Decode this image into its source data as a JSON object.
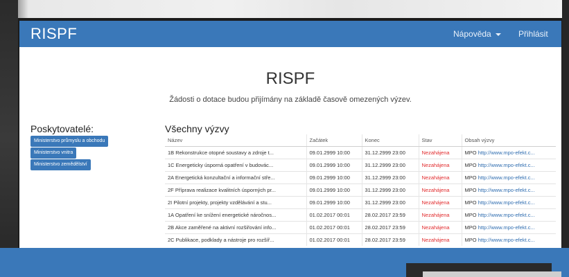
{
  "navbar": {
    "brand": "RISPF",
    "help_label": "Nápověda",
    "login_label": "Přihlásit"
  },
  "hero": {
    "title": "RISPF",
    "subtitle": "Žádosti o dotace budou přijímány na základě časově omezených výzev."
  },
  "providers": {
    "heading": "Poskytovatelé:",
    "items": [
      "Ministerstvo průmyslu a obchodu",
      "Ministerstvo vnitra",
      "Ministerstvo zemědělství"
    ]
  },
  "calls": {
    "heading": "Všechny výzvy",
    "columns": [
      "Název",
      "Začátek",
      "Konec",
      "Stav",
      "Obsah výzvy"
    ],
    "rows": [
      {
        "name": "1B Rekonstrukce otopné soustavy a zdroje t...",
        "start": "09.01.2999 10:00",
        "end": "31.12.2999 23:00",
        "status": "Nezahájena",
        "prefix": "MPO",
        "link": "http://www.mpo-efekt.c..."
      },
      {
        "name": "1C Energeticky úsporná opatření v budovác...",
        "start": "09.01.2999 10:00",
        "end": "31.12.2999 23:00",
        "status": "Nezahájena",
        "prefix": "MPO",
        "link": "http://www.mpo-efekt.c..."
      },
      {
        "name": "2A Energetická konzultační a informační stře...",
        "start": "09.01.2999 10:00",
        "end": "31.12.2999 23:00",
        "status": "Nezahájena",
        "prefix": "MPO",
        "link": "http://www.mpo-efekt.c..."
      },
      {
        "name": "2F Příprava realizace kvalitních úsporných pr...",
        "start": "09.01.2999 10:00",
        "end": "31.12.2999 23:00",
        "status": "Nezahájena",
        "prefix": "MPO",
        "link": "http://www.mpo-efekt.c..."
      },
      {
        "name": "2I Pilotní projekty, projekty vzdělávání a stu...",
        "start": "09.01.2999 10:00",
        "end": "31.12.2999 23:00",
        "status": "Nezahájena",
        "prefix": "MPO",
        "link": "http://www.mpo-efekt.c..."
      },
      {
        "name": "1A Opatření ke snížení energetické náročnos...",
        "start": "01.02.2017 00:01",
        "end": "28.02.2017 23:59",
        "status": "Nezahájena",
        "prefix": "MPO",
        "link": "http://www.mpo-efekt.c..."
      },
      {
        "name": "2B Akce zaměřené na aktivní rozšiřování info...",
        "start": "01.02.2017 00:01",
        "end": "28.02.2017 23:59",
        "status": "Nezahájena",
        "prefix": "MPO",
        "link": "http://www.mpo-efekt.c..."
      },
      {
        "name": "2C Publikace, podklady a nástroje pro rozšíř...",
        "start": "01.02.2017 00:01",
        "end": "28.02.2017 23:59",
        "status": "Nezahájena",
        "prefix": "MPO",
        "link": "http://www.mpo-efekt.c..."
      }
    ]
  },
  "colors": {
    "brand": "#3a78b9",
    "status": "#e1292b",
    "link": "#2f6db0"
  }
}
